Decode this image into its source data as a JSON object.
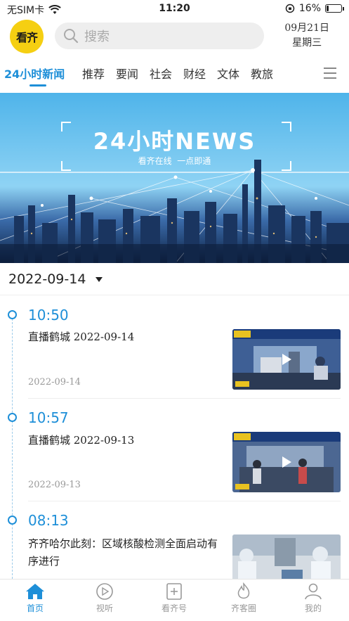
{
  "status": {
    "carrier": "无SIM卡",
    "time": "11:20",
    "battery": "16%",
    "battery_level": 0.16
  },
  "header": {
    "logo_text": "看齐",
    "search_placeholder": "搜索",
    "date": "09月21日",
    "weekday": "星期三"
  },
  "tabs": [
    "24小时新闻",
    "推荐",
    "要闻",
    "社会",
    "财经",
    "文体",
    "教旅"
  ],
  "banner": {
    "title": "24小时NEWS",
    "subtitle": "看齐在线  一点即通"
  },
  "date_filter": "2022-09-14",
  "news": [
    {
      "time": "10:50",
      "title": "直播鹤城 2022-09-14",
      "date": "2022-09-14",
      "thumb_type": "video"
    },
    {
      "time": "10:57",
      "title": "直播鹤城 2022-09-13",
      "date": "2022-09-13",
      "thumb_type": "video"
    },
    {
      "time": "08:13",
      "title": "齐齐哈尔此刻：区域核酸检测全面启动有序进行",
      "date": "",
      "thumb_type": "image"
    }
  ],
  "bottom_nav": [
    {
      "label": "首页",
      "icon": "home-icon",
      "active": true
    },
    {
      "label": "视听",
      "icon": "play-circle-icon",
      "active": false
    },
    {
      "label": "看齐号",
      "icon": "plus-square-icon",
      "active": false
    },
    {
      "label": "齐客圈",
      "icon": "flame-icon",
      "active": false
    },
    {
      "label": "我的",
      "icon": "user-icon",
      "active": false
    }
  ],
  "colors": {
    "accent": "#1e8fd8",
    "logo_bg": "#f5cf12"
  }
}
